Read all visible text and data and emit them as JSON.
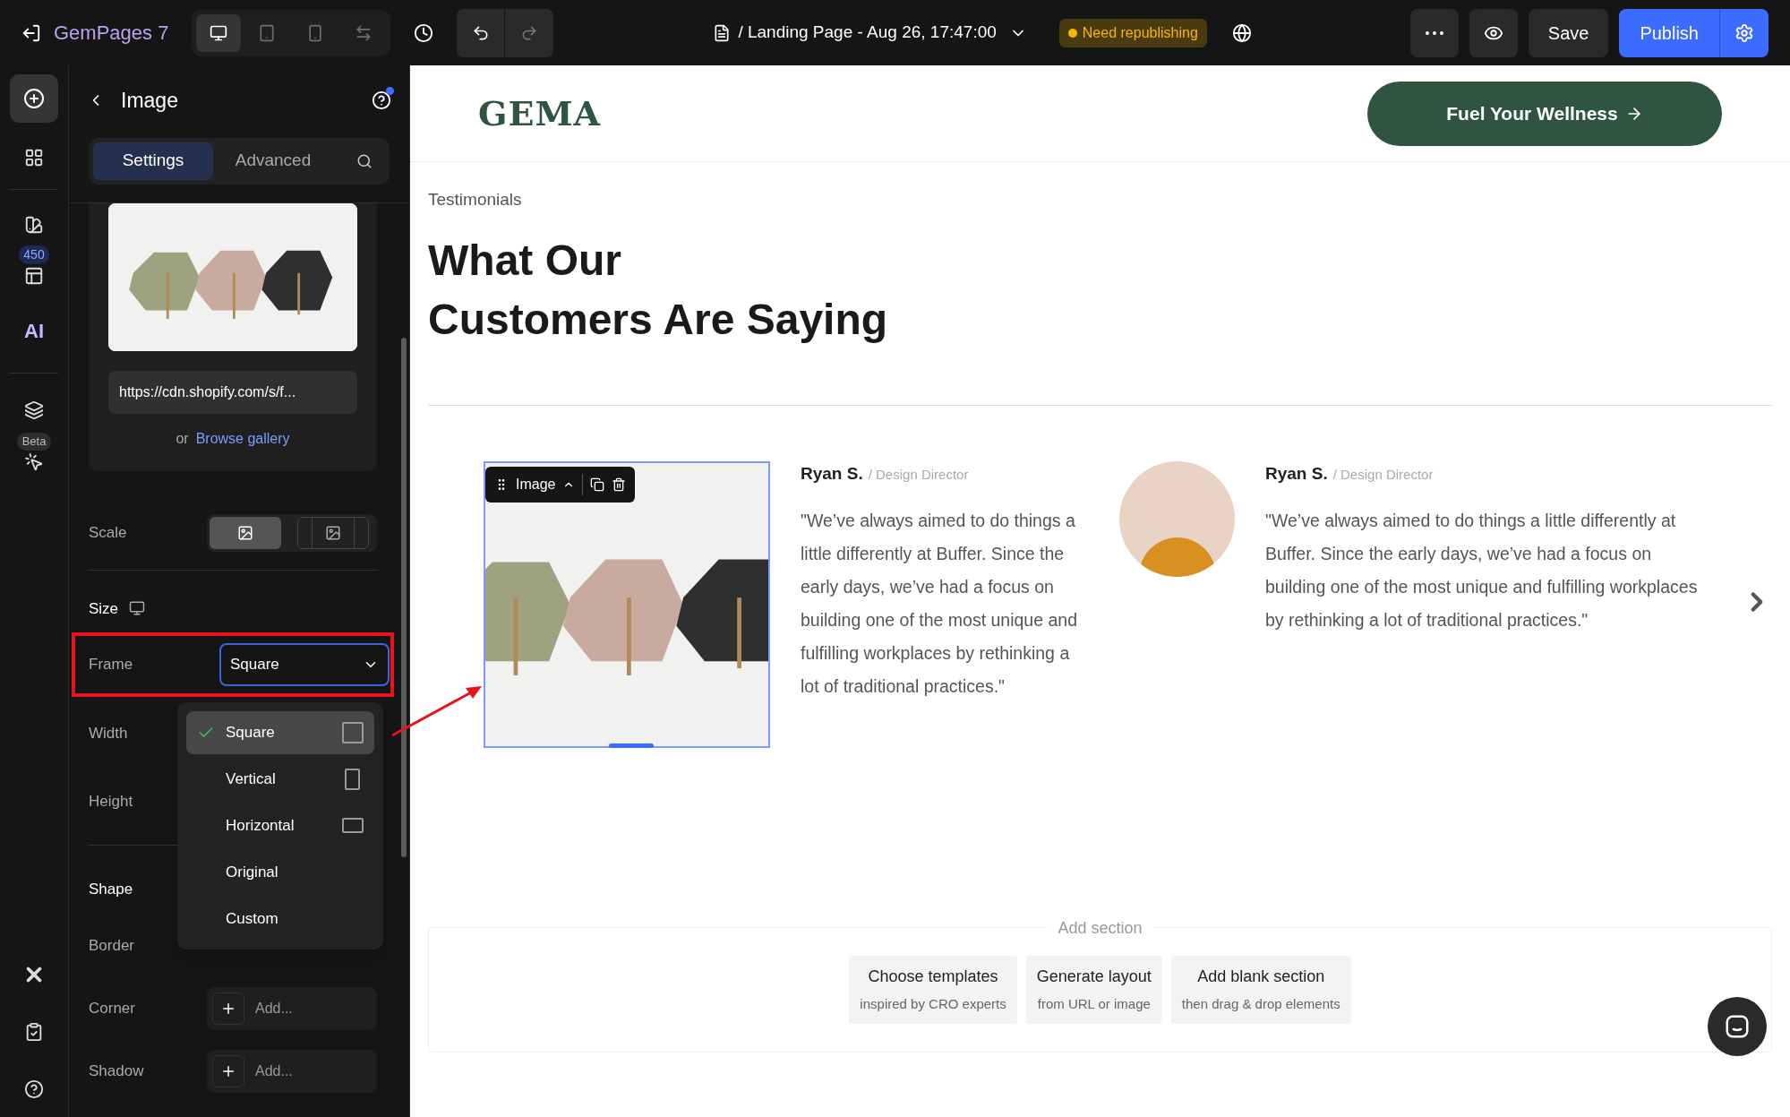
{
  "topbar": {
    "brand": "GemPages 7",
    "devices": [
      {
        "kind": "desktop",
        "selected": true
      },
      {
        "kind": "tablet",
        "selected": false
      },
      {
        "kind": "mobile",
        "selected": false
      },
      {
        "kind": "fit",
        "selected": false
      }
    ],
    "page_title": "/ Landing Page - Aug 26, 17:47:00",
    "status_badge": "Need republishing",
    "save": "Save",
    "publish": "Publish"
  },
  "rail": {
    "library_badge": "450",
    "ai_label": "AI",
    "beta_badge": "Beta"
  },
  "panel": {
    "title": "Image",
    "tabs": [
      {
        "label": "Settings",
        "selected": true
      },
      {
        "label": "Advanced",
        "selected": false
      }
    ],
    "url": "https://cdn.shopify.com/s/f...",
    "or_text": "or",
    "browse_link": "Browse gallery",
    "scale_label": "Scale",
    "scale_options": [
      {
        "kind": "fill",
        "selected": true
      },
      {
        "kind": "fit",
        "selected": false
      }
    ],
    "size_label": "Size",
    "frame_label": "Frame",
    "frame_value": "Square",
    "frame_options": [
      {
        "label": "Square",
        "kind": "square",
        "selected": true
      },
      {
        "label": "Vertical",
        "kind": "vertical",
        "selected": false
      },
      {
        "label": "Horizontal",
        "kind": "horizontal",
        "selected": false
      },
      {
        "label": "Original",
        "kind": "none",
        "selected": false
      },
      {
        "label": "Custom",
        "kind": "none",
        "selected": false
      }
    ],
    "width_label": "Width",
    "height_label": "Height",
    "shape_heading": "Shape",
    "border_label": "Border",
    "corner_label": "Corner",
    "corner_placeholder": "Add...",
    "shadow_label": "Shadow",
    "shadow_placeholder": "Add..."
  },
  "canvas": {
    "logo": "GEMA",
    "cta": "Fuel Your Wellness",
    "eyebrow": "Testimonials",
    "heading": [
      "What Our",
      "Customers Are Saying"
    ],
    "toolbar_label": "Image",
    "testimonials": [
      {
        "kind": "product",
        "name": "Ryan S.",
        "role": "/ Design Director",
        "quote": "\"We’ve always aimed to do things a little differently at Buffer. Since the early days, we’ve had a focus on building one of the most unique and fulfilling workplaces by rethinking a lot of traditional practices.\""
      },
      {
        "kind": "person",
        "name": "Ryan S.",
        "role": "/ Design Director",
        "quote": "\"We’ve always aimed to do things a little differently at Buffer. Since the early days, we’ve had a focus on building one of the most unique and fulfilling workplaces by rethinking a lot of traditional practices.\""
      }
    ],
    "add_section": {
      "label": "Add section",
      "options": [
        {
          "title": "Choose templates",
          "subtitle": "inspired by CRO experts"
        },
        {
          "title": "Generate layout",
          "subtitle": "from URL or image"
        },
        {
          "title": "Add blank section",
          "subtitle": "then drag & drop elements"
        }
      ]
    }
  }
}
